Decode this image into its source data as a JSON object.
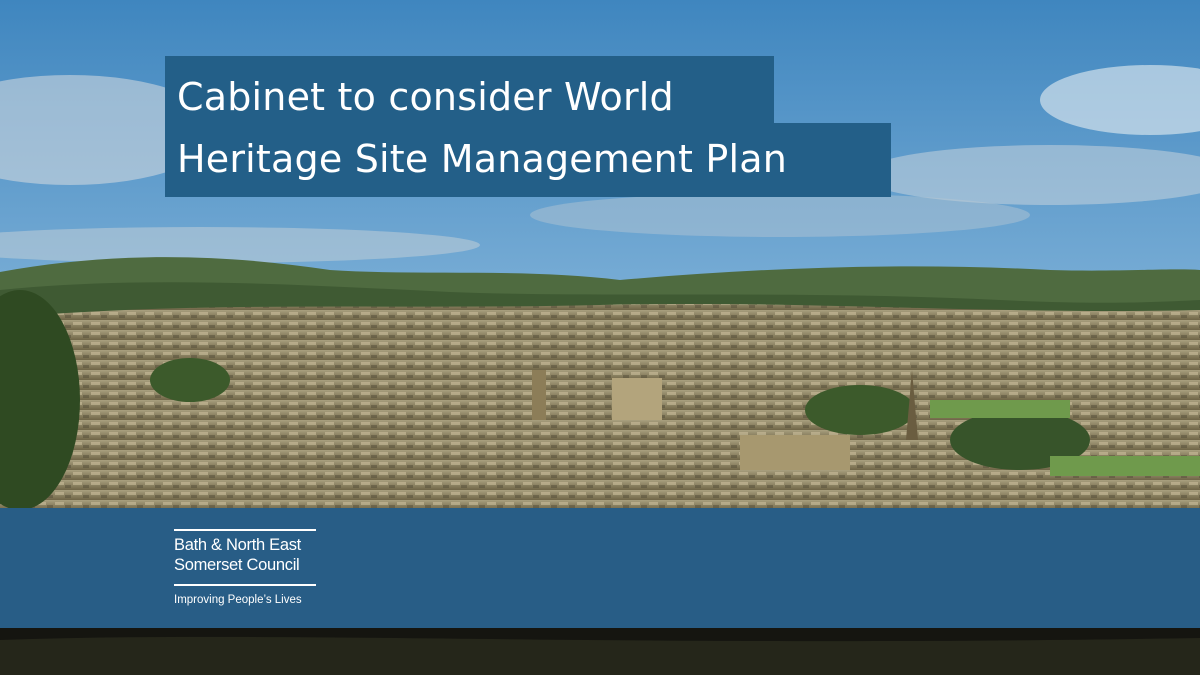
{
  "headline": {
    "line1": "Cabinet to consider World",
    "line2": "Heritage Site Management Plan"
  },
  "logo": {
    "name_line1": "Bath & North East",
    "name_line2": "Somerset Council",
    "tagline": "Improving People’s Lives"
  },
  "colors": {
    "banner": "#235f88",
    "footer_band": "#285d86",
    "text": "#ffffff"
  }
}
